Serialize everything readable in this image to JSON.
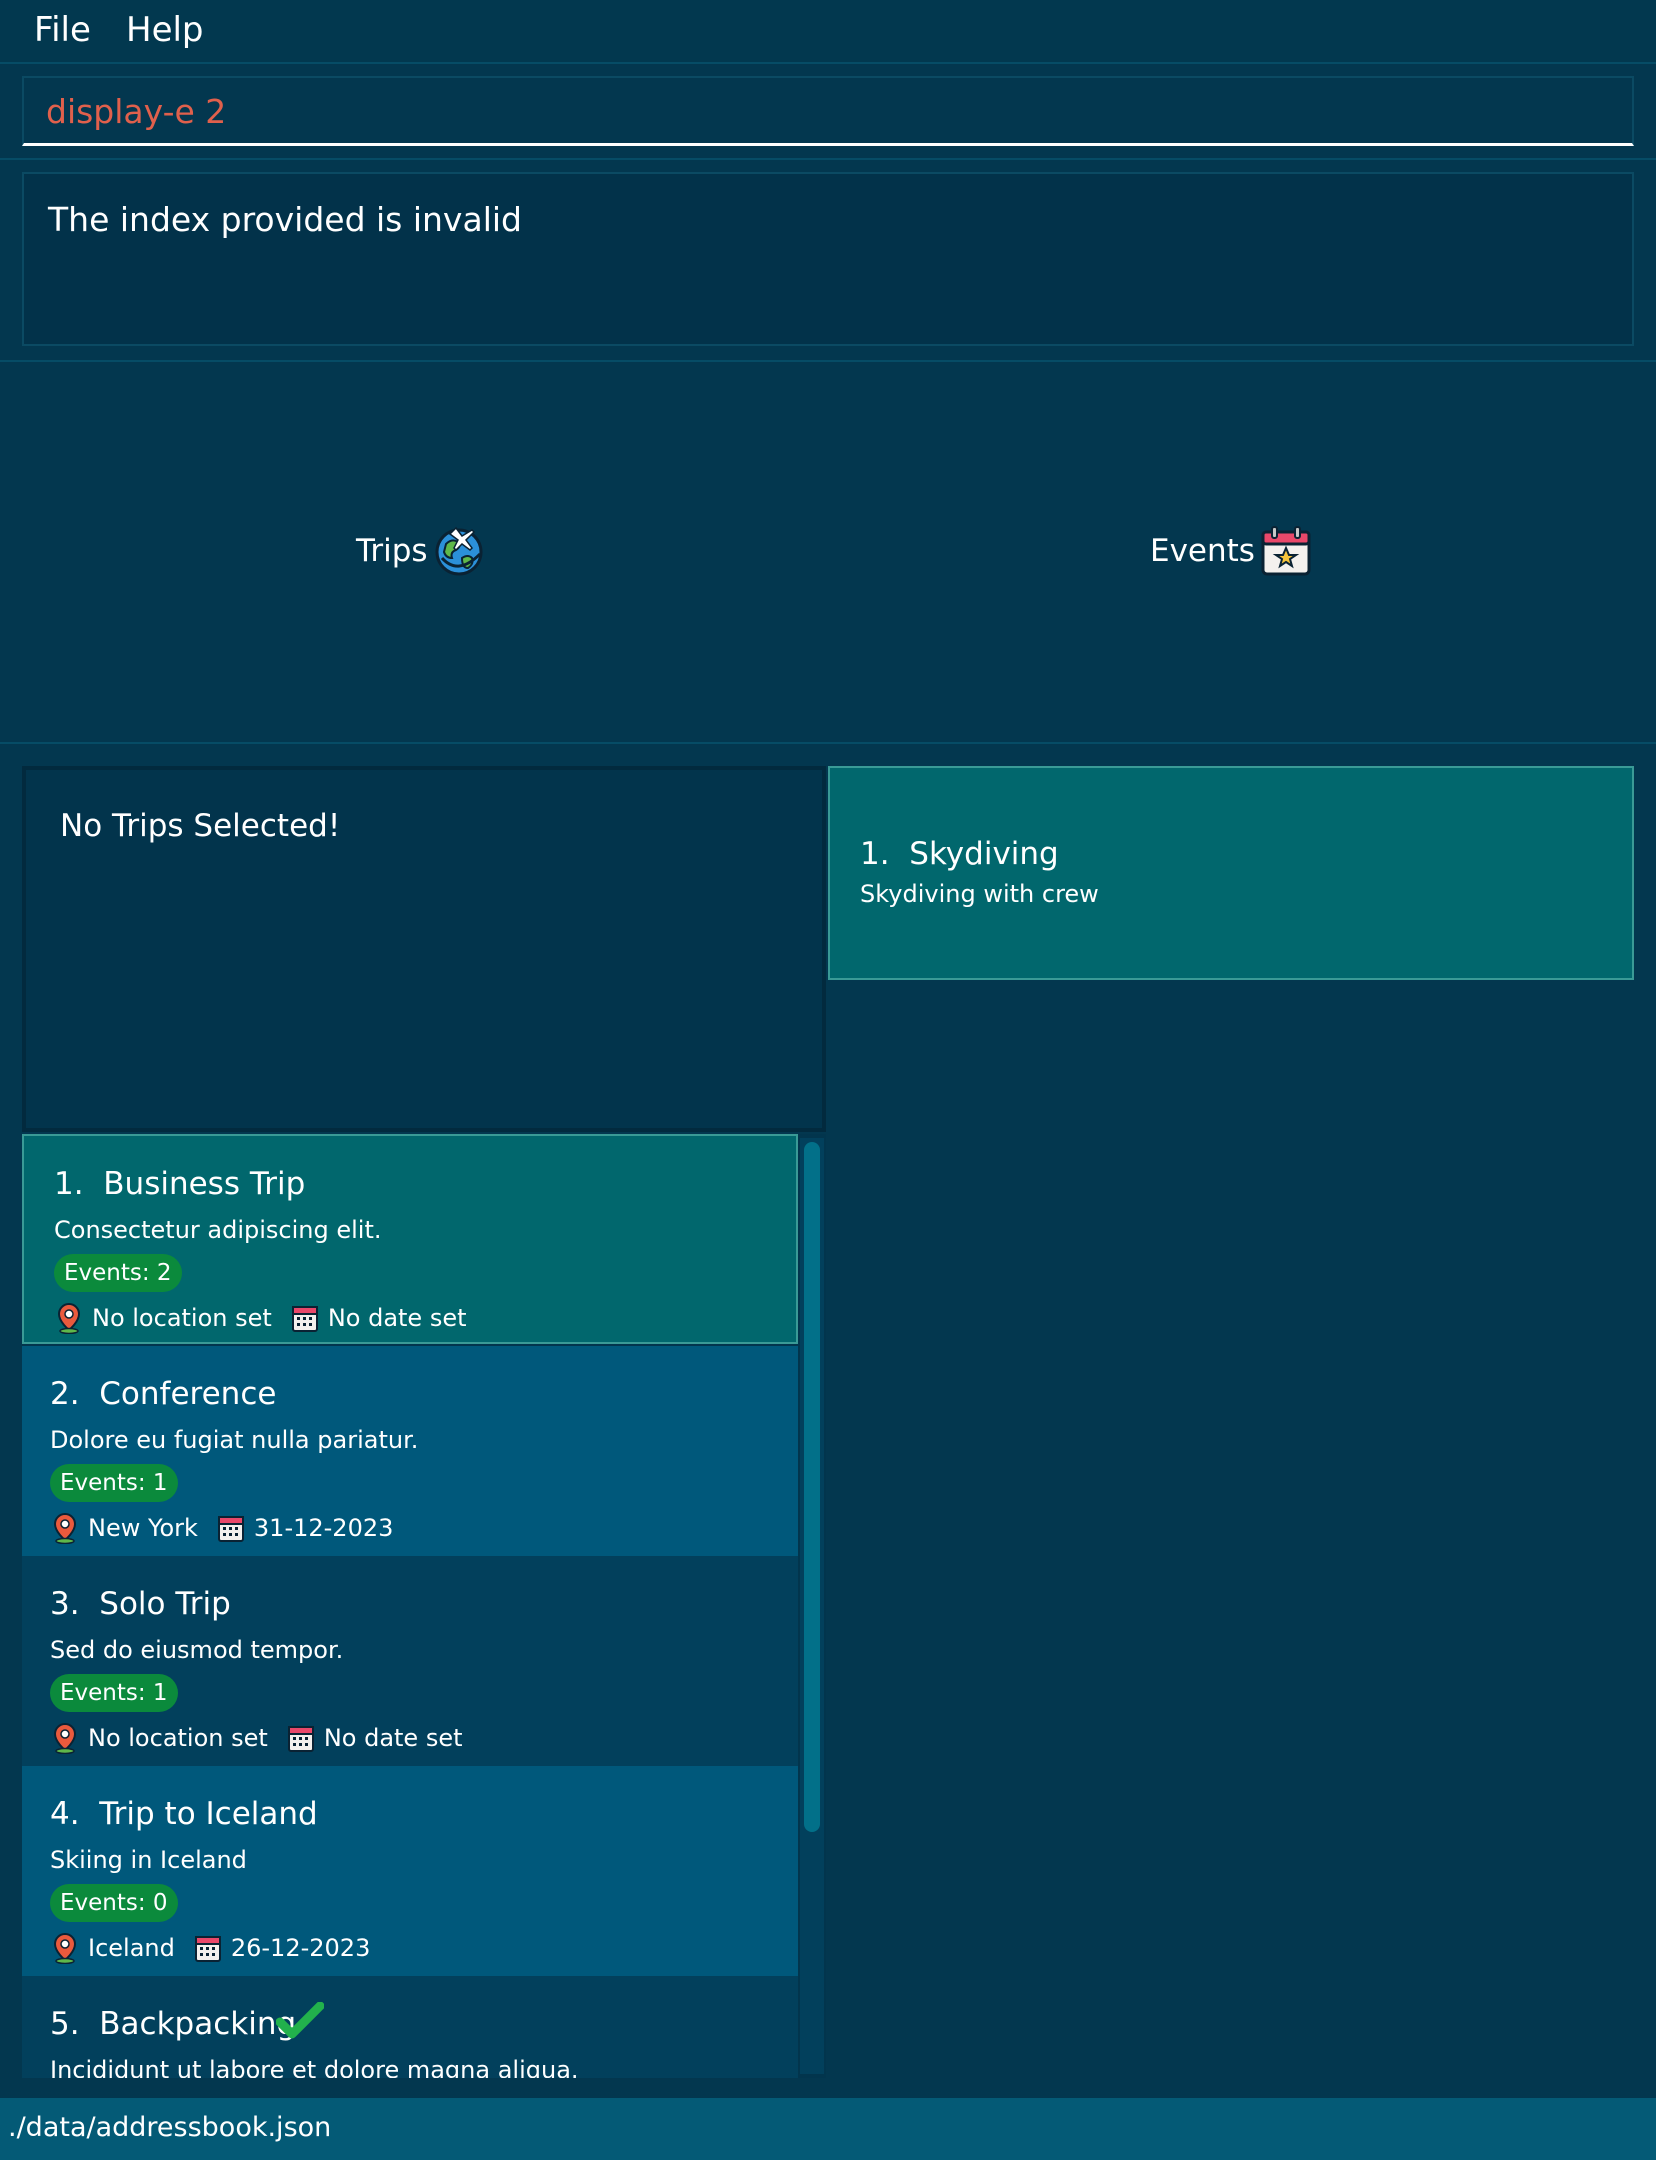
{
  "menu": {
    "file": "File",
    "help": "Help"
  },
  "command": {
    "value": "display-e 2",
    "placeholder": ""
  },
  "result": {
    "message": "The index provided is invalid"
  },
  "tabs": {
    "trips": {
      "label": "Trips",
      "icon": "globe-plane-icon"
    },
    "events": {
      "label": "Events",
      "icon": "calendar-star-icon"
    }
  },
  "selected_trip": {
    "message": "No Trips Selected!"
  },
  "trips": [
    {
      "title": "1.  Business Trip",
      "description": "Consectetur adipiscing elit.",
      "events": "Events: 2",
      "location": "No location set",
      "date": "No date set"
    },
    {
      "title": "2.  Conference",
      "description": "Dolore eu fugiat nulla pariatur.",
      "events": "Events: 1",
      "location": "New York",
      "date": "31-12-2023"
    },
    {
      "title": "3.  Solo Trip",
      "description": "Sed do eiusmod tempor.",
      "events": "Events: 1",
      "location": "No location set",
      "date": "No date set"
    },
    {
      "title": "4.  Trip to Iceland",
      "description": "Skiing in Iceland",
      "events": "Events: 0",
      "location": "Iceland",
      "date": "26-12-2023"
    },
    {
      "title": "5.  Backpacking",
      "description": "Incididunt ut labore et dolore magna aliqua.",
      "completed_icon": "checkmark-icon"
    }
  ],
  "events": [
    {
      "title": "1.  Skydiving",
      "description": "Skydiving with crew"
    }
  ],
  "status": {
    "path": "./data/addressbook.json"
  },
  "colors": {
    "background": "#03374f",
    "command_text": "#e0604c",
    "selected_card": "#01676d",
    "badge": "#0b8a3c",
    "status_bar": "#045a76"
  }
}
